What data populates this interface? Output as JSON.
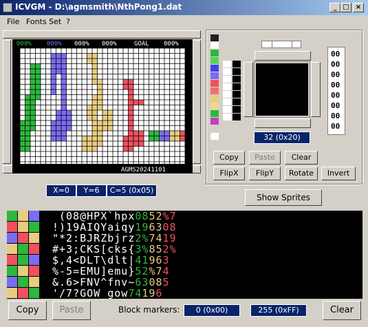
{
  "window": {
    "title": "ICVGM - D:\\agmsmith\\NthPong1.dat",
    "minimize": "_",
    "maximize": "□",
    "close": "×"
  },
  "menu": {
    "file": "File",
    "fonts_set": "Fonts Set",
    "help": "?"
  },
  "status_line": {
    "p1": "000%",
    "p2": "000%",
    "p3": "000%",
    "p4": "000%",
    "goal": "GOAL",
    "goal_val": "000%"
  },
  "canvas_footer": "AGMS20241101",
  "coords": {
    "x": "X=0",
    "y": "Y=6",
    "c": "C=5 (0x05)"
  },
  "sprite": {
    "label": "32 (0x20)",
    "numbers": [
      "00",
      "00",
      "00",
      "00",
      "00",
      "00",
      "00",
      "00"
    ]
  },
  "buttons": {
    "copy": "Copy",
    "paste": "Paste",
    "clear": "Clear",
    "flipx": "FlipX",
    "flipy": "FlipY",
    "rotate": "Rotate",
    "invert": "Invert",
    "show_sprites": "Show Sprites"
  },
  "bottom": {
    "copy": "Copy",
    "paste": "Paste",
    "block_markers": "Block markers:",
    "marker_start": "0 (0x00)",
    "marker_end": "255 (0xFF)",
    "clear": "Clear"
  },
  "charset_rows": [
    {
      "white": " (08@HPX`hpx",
      "green": "08",
      "yellow": "52",
      "red": "%7"
    },
    {
      "white": "!)19AIQYaiqy",
      "green": "19",
      "yellow": "63",
      "red": "08"
    },
    {
      "white": "\"*2:BJRZbjrz",
      "green": "2%",
      "yellow": "74",
      "red": "19"
    },
    {
      "white": "#+3;CKS[cks{",
      "green": "3%",
      "yellow": "85",
      "red": "2%"
    },
    {
      "white": "$,4<DLT\\dlt|",
      "green": "41",
      "yellow": "96",
      "red": "3"
    },
    {
      "white": "%-5=EMU]emu}",
      "green": "52",
      "yellow": "%7",
      "red": "4"
    },
    {
      "white": "&.6>FNV^fnv~",
      "green": "63",
      "yellow": "08",
      "red": "5"
    },
    {
      "white": "'/7?GOW_gow",
      "green": "74",
      "yellow": "19",
      "red": "6"
    }
  ],
  "colors": {
    "accent": "#0a246a",
    "green": "#2db83d",
    "blue": "#7b6cf0",
    "yellow": "#e8cc80",
    "red": "#f05060"
  }
}
